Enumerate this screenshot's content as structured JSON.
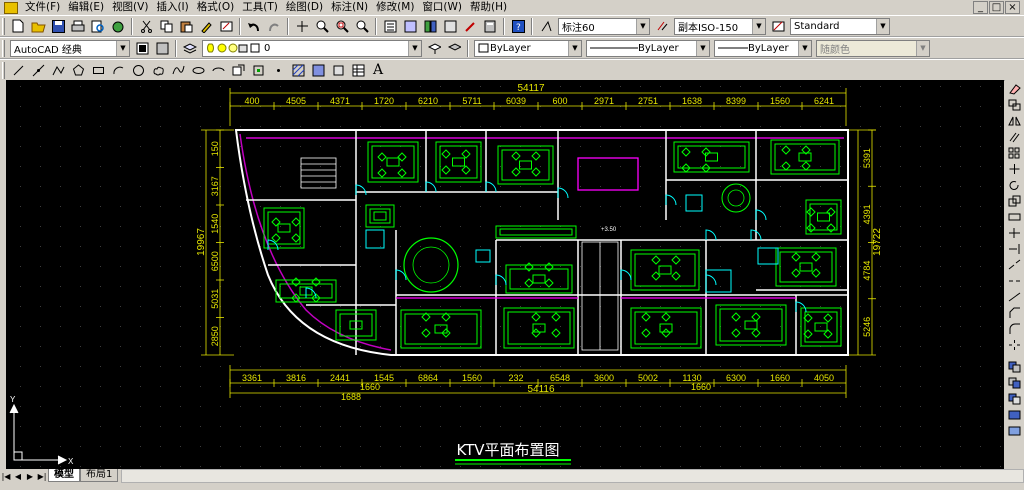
{
  "menubar": {
    "items": [
      "文件(F)",
      "编辑(E)",
      "视图(V)",
      "插入(I)",
      "格式(O)",
      "工具(T)",
      "绘图(D)",
      "标注(N)",
      "修改(M)",
      "窗口(W)",
      "帮助(H)"
    ],
    "controls": [
      "_",
      "□",
      "×"
    ]
  },
  "toolbar1": {
    "dimstyle": "标注60",
    "textstyle": "副本ISO-150",
    "tablestyle": "Standard"
  },
  "toolbar2": {
    "workspace": "AutoCAD 经典",
    "layer": "0",
    "color": "ByLayer",
    "linetype": "ByLayer",
    "lineweight": "ByLayer",
    "plotstyle": "随颜色"
  },
  "toolbar3": {
    "text_icon": "A"
  },
  "drawing": {
    "title": "KTV平面布置图",
    "top_total": "54117",
    "top_dims": [
      "400",
      "4505",
      "4371",
      "1720",
      "6210",
      "5711",
      "6039",
      "600",
      "2971",
      "2751",
      "1638",
      "8399",
      "1560",
      "6241"
    ],
    "bottom_total": "54116",
    "bottom_dims": [
      "3361",
      "3816",
      "2441",
      "1545",
      "6864",
      "1560",
      "232",
      "6548",
      "3600",
      "5002",
      "1130",
      "6300",
      "1660",
      "4050"
    ],
    "bottom_small": [
      "1660",
      "1660",
      "1688"
    ],
    "left_dims": [
      "150",
      "3167",
      "1540",
      "6500",
      "5031",
      "2850"
    ],
    "left_total": "19967",
    "right_dims": [
      "5391",
      "4391",
      "4784",
      "5246"
    ],
    "right_total": "19722",
    "room_label": "+3.50"
  },
  "tabs": {
    "model": "模型",
    "layout1": "布局1"
  },
  "colors": {
    "bg": "#000000",
    "dim": "#e6e600",
    "wall": "#ffffff",
    "furn": "#00ff00",
    "door": "#00ffff",
    "glass": "#ff00ff"
  }
}
